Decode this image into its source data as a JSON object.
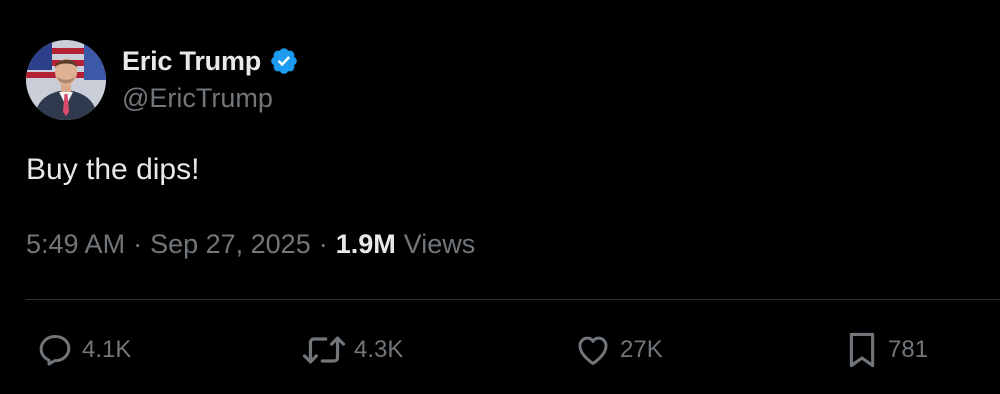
{
  "author": {
    "display_name": "Eric Trump",
    "handle": "@EricTrump",
    "verified": true,
    "verified_color": "#1d9bf0"
  },
  "tweet": {
    "text": "Buy the dips!",
    "time": "5:49 AM",
    "date": "Sep 27, 2025",
    "separator": "·",
    "views_count": "1.9M",
    "views_label": "Views"
  },
  "actions": {
    "reply": {
      "icon": "reply-icon",
      "count": "4.1K"
    },
    "retweet": {
      "icon": "retweet-icon",
      "count": "4.3K"
    },
    "like": {
      "icon": "heart-icon",
      "count": "27K"
    },
    "bookmark": {
      "icon": "bookmark-icon",
      "count": "781"
    }
  },
  "colors": {
    "background": "#000000",
    "primary_text": "#e7e9ea",
    "secondary_text": "#71767b",
    "divider": "#2f3336"
  }
}
